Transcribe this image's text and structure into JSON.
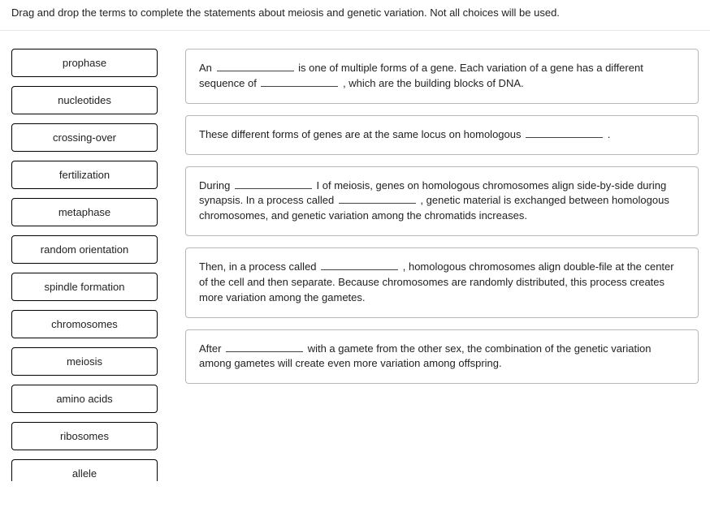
{
  "instructions": "Drag and drop the terms to complete the statements about meiosis and genetic variation. Not all choices will be used.",
  "terms": [
    {
      "label": "prophase"
    },
    {
      "label": "nucleotides"
    },
    {
      "label": "crossing-over"
    },
    {
      "label": "fertilization"
    },
    {
      "label": "metaphase"
    },
    {
      "label": "random orientation"
    },
    {
      "label": "spindle formation"
    },
    {
      "label": "chromosomes"
    },
    {
      "label": "meiosis"
    },
    {
      "label": "amino acids"
    },
    {
      "label": "ribosomes"
    },
    {
      "label": "allele"
    }
  ],
  "statements": [
    {
      "parts": [
        "An ",
        "BLANK",
        " is one of multiple forms of a gene. Each variation of a gene has a different sequence of ",
        "BLANK",
        " , which are the building blocks of DNA."
      ]
    },
    {
      "parts": [
        "These different forms of genes are at the same locus on homologous ",
        "BLANK",
        " ."
      ]
    },
    {
      "parts": [
        "During ",
        "BLANK",
        " I of meiosis, genes on homologous chromosomes align side-by-side during synapsis. In a process called ",
        "BLANK",
        " , genetic material is exchanged between homologous chromosomes, and genetic variation among the chromatids increases."
      ]
    },
    {
      "parts": [
        "Then, in a process called ",
        "BLANK",
        " , homologous chromosomes align double-file at the center of the cell and then separate. Because chromosomes are randomly distributed, this process creates more variation among the gametes."
      ]
    },
    {
      "parts": [
        "After ",
        "BLANK",
        " with a gamete from the other sex, the combination of the genetic variation among gametes will create even more variation among offspring."
      ]
    }
  ]
}
